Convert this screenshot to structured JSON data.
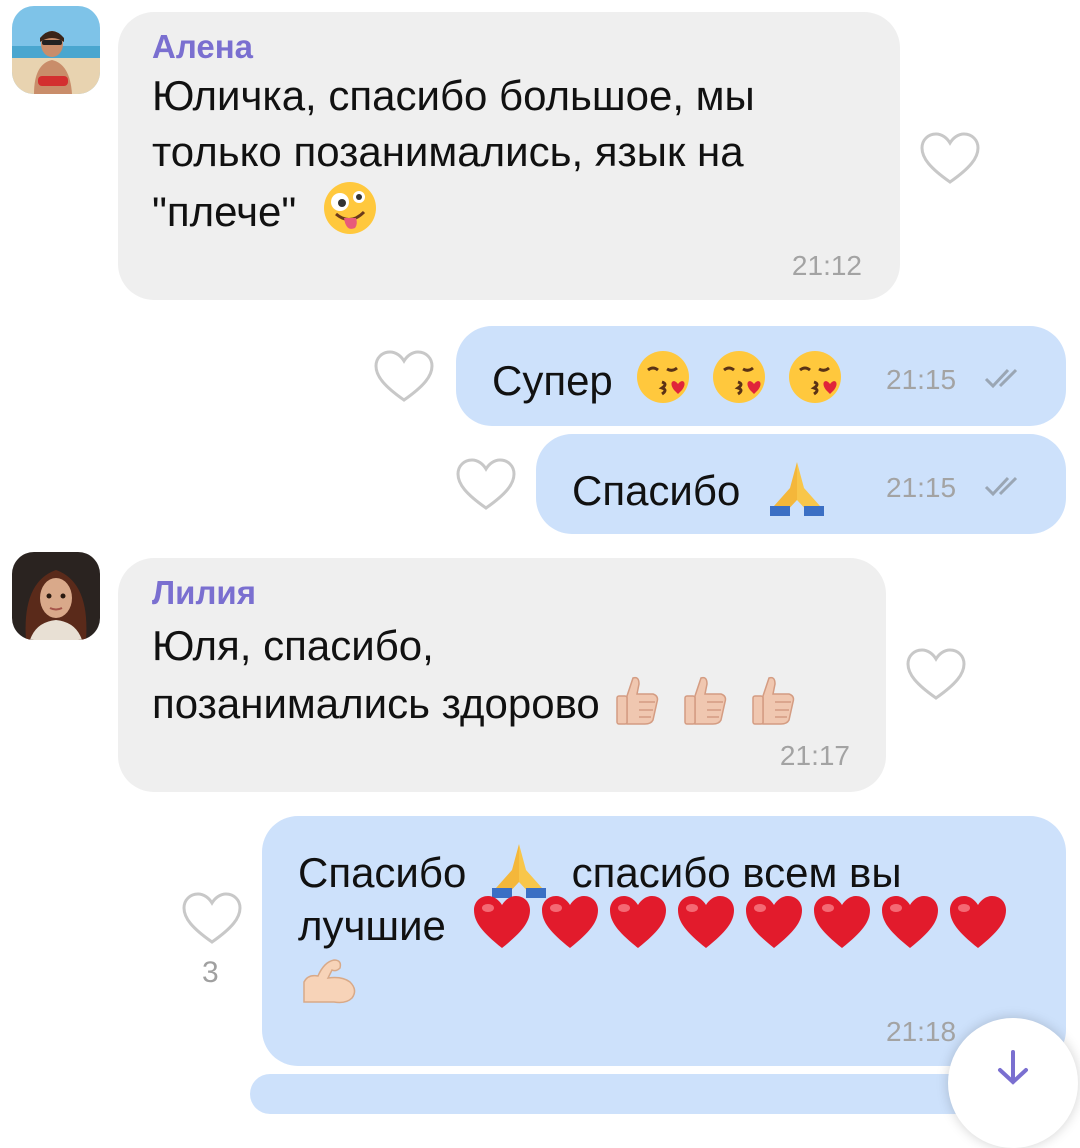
{
  "messages": [
    {
      "sender": "Алена",
      "lines": [
        "Юличка, спасибо большое, мы",
        "только позанимались, язык на",
        "\"плече\""
      ],
      "time": "21:12"
    },
    {
      "text": "Супер",
      "time": "21:15"
    },
    {
      "text": "Спасибо",
      "time": "21:15"
    },
    {
      "sender": "Лилия",
      "lines": [
        "Юля, спасибо,",
        "позанимались здорово"
      ],
      "time": "21:17"
    },
    {
      "lines": [
        "Спасибо",
        "спасибо всем вы",
        "лучшие"
      ],
      "time": "21:18",
      "likes": "3"
    }
  ],
  "colors": {
    "incoming_bubble": "#efefef",
    "outgoing_bubble": "#cde1fb",
    "sender_name": "#7a6fd0",
    "time": "#a3a3a3"
  },
  "icons": [
    "heart-outline-icon",
    "double-check-icon",
    "crazy-face-emoji",
    "kissing-heart-emoji",
    "praying-hands-emoji",
    "thumbs-up-emoji",
    "red-heart-emoji",
    "flexed-biceps-emoji",
    "scroll-down-icon"
  ]
}
